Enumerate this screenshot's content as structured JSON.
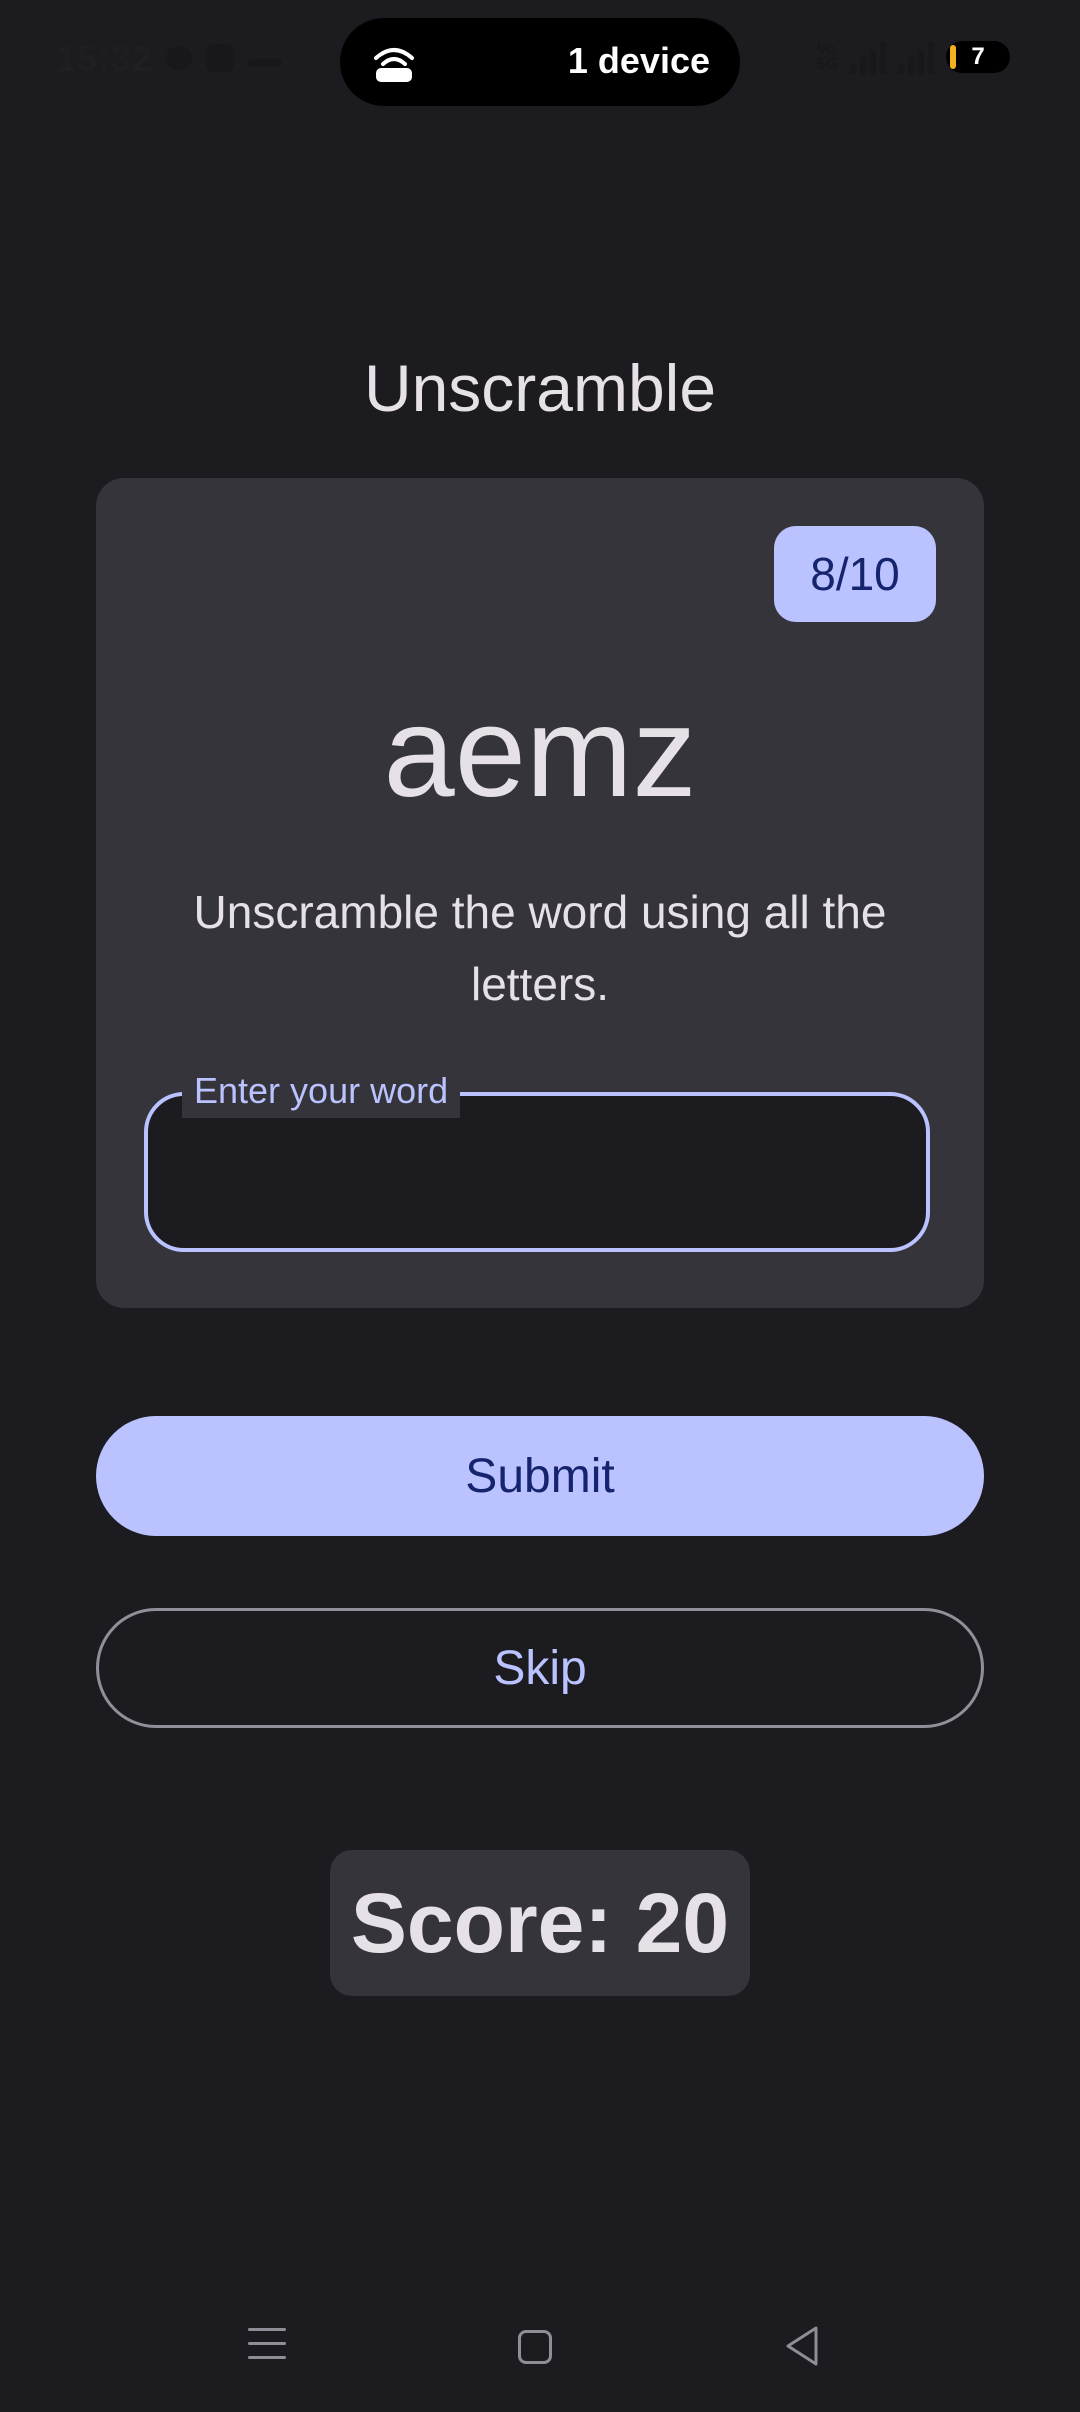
{
  "status_bar": {
    "time": "15:32",
    "device_pill_text": "1 device",
    "battery_level": "7",
    "icons": [
      "chat-icon",
      "app-icon",
      "more-icon",
      "volte-icon",
      "signal-icon",
      "5g-signal-icon",
      "battery-icon",
      "hotspot-icon"
    ]
  },
  "app": {
    "title": "Unscramble"
  },
  "card": {
    "counter": "8/10",
    "scrambled_word": "aemz",
    "instructions": "Unscramble the word using all the letters.",
    "input_label": "Enter your word",
    "input_value": ""
  },
  "actions": {
    "submit_label": "Submit",
    "skip_label": "Skip"
  },
  "score": {
    "text": "Score: 20"
  },
  "nav_bar": {
    "icons": [
      "menu-icon",
      "home-icon",
      "back-icon"
    ]
  },
  "colors": {
    "background": "#1c1b20",
    "surface": "#35343a",
    "primary": "#bac3ff",
    "on_primary": "#16246e",
    "text": "#e6e1e6",
    "outline": "#918f9a"
  }
}
